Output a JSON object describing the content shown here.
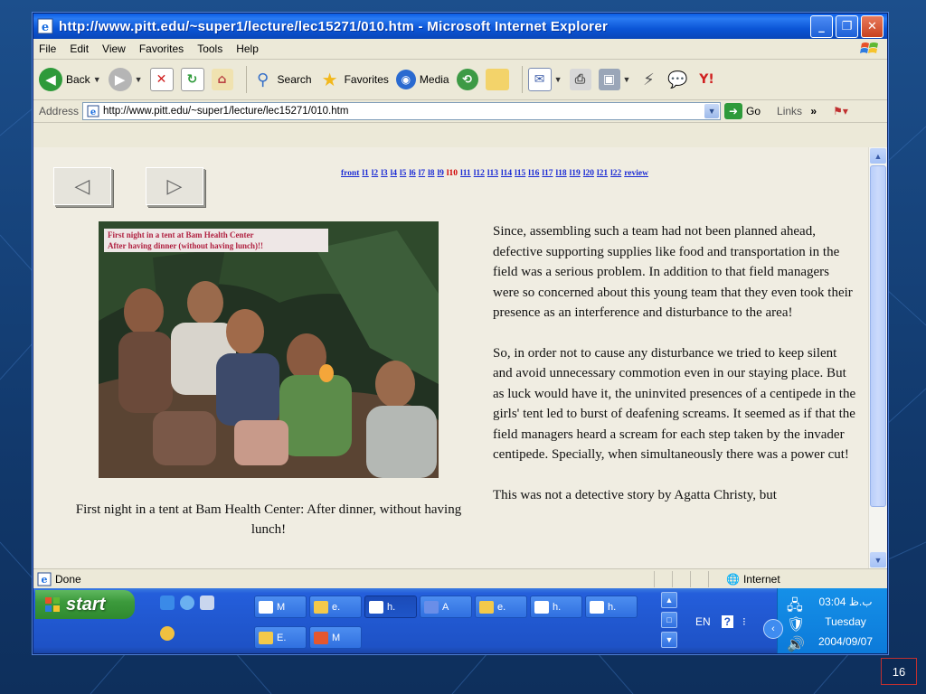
{
  "window": {
    "title": "http://www.pitt.edu/~super1/lecture/lec15271/010.htm - Microsoft Internet Explorer",
    "minimize": "_",
    "restore": "❐",
    "close": "✕"
  },
  "menu": [
    "File",
    "Edit",
    "View",
    "Favorites",
    "Tools",
    "Help"
  ],
  "toolbar": {
    "back": "Back",
    "search": "Search",
    "favorites": "Favorites",
    "media": "Media"
  },
  "address": {
    "label": "Address",
    "url": "http://www.pitt.edu/~super1/lecture/lec15271/010.htm",
    "go": "Go",
    "links": "Links",
    "links_more": "»"
  },
  "page": {
    "prev_glyph": "◁",
    "next_glyph": "▷",
    "nav_links": [
      "front",
      "l1",
      "l2",
      "l3",
      "l4",
      "l5",
      "l6",
      "l7",
      "l8",
      "l9",
      "l10",
      "l11",
      "l12",
      "l13",
      "l14",
      "l15",
      "l16",
      "l17",
      "l18",
      "l19",
      "l20",
      "l21",
      "l22",
      "review"
    ],
    "current_link": "l10",
    "photo_label_line1": "First night in a tent at Bam Health Center",
    "photo_label_line2": "After having dinner (without having lunch)!!",
    "caption": "First night in a tent at Bam Health Center: After dinner, without having lunch!",
    "paragraphs": [
      "Since, assembling such a team had not been planned ahead, defective supporting supplies like food and transportation in the field was a serious problem. In addition to that field managers were so concerned about this young team that they even took their presence as an interference and disturbance to the area!",
      "So, in order not to cause any disturbance we tried to keep silent and avoid unnecessary commotion even in our staying place. But as luck would have it, the uninvited presences of a centipede in the girls' tent led to burst of deafening screams. It seemed as if that the field managers heard a scream for each step taken by the invader centipede. Specially, when simultaneously there was a power cut!",
      "This was not a detective story by Agatta Christy, but"
    ]
  },
  "status": {
    "text": "Done",
    "zone": "Internet"
  },
  "taskbar": {
    "start": "start",
    "tasks_row1": [
      {
        "label": "M",
        "color": "#ffffff",
        "active": false
      },
      {
        "label": "e.",
        "color": "#f3c94a",
        "active": false
      },
      {
        "label": "h.",
        "color": "#ffffff",
        "active": true
      },
      {
        "label": "A",
        "color": "#6a8ee8",
        "active": false
      },
      {
        "label": "e.",
        "color": "#f3c94a",
        "active": false
      },
      {
        "label": "h.",
        "color": "#ffffff",
        "active": false
      },
      {
        "label": "h.",
        "color": "#ffffff",
        "active": false
      }
    ],
    "tasks_row2": [
      {
        "label": "E.",
        "color": "#f3c94a",
        "active": false
      },
      {
        "label": "M",
        "color": "#e4572e",
        "active": false
      }
    ],
    "lang": "EN",
    "time": "03:04 ب.ظ",
    "day": "Tuesday",
    "date": "2004/09/07"
  },
  "slide_number": "16"
}
